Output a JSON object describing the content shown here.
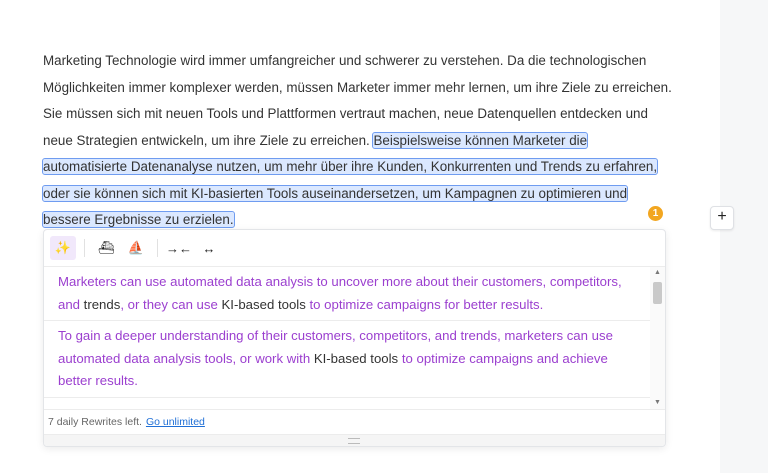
{
  "editor": {
    "lead_text": "Marketing Technologie wird immer umfangreicher und schwerer zu verstehen. Da die technologischen Möglichkeiten immer komplexer werden, müssen Marketer immer mehr lernen, um ihre Ziele zu erreichen. Sie müssen sich mit neuen Tools und Plattformen vertraut machen, neue Datenquellen entdecken und neue Strategien entwickeln, um ihre Ziele zu erreichen. ",
    "selected_text": "Beispielsweise können Marketer die automatisierte Datenanalyse nutzen, um mehr über ihre Kunden, Konkurrenten und Trends zu erfahren, oder sie können sich mit KI-basierten Tools auseinandersetzen, um Kampagnen zu optimieren und bessere Ergebnisse zu erzielen."
  },
  "issue_count": "1",
  "add_block_label": "+",
  "toolbar": {
    "rewrite_icon": "sparkle-icon",
    "formal_icon": "boat-icon",
    "casual_icon": "ship-icon",
    "shorten_icon": "arrows-in-icon",
    "expand_icon": "arrows-out-icon",
    "rewrite_glyph": "✨",
    "formal_glyph": "⛴",
    "casual_glyph": "⛵",
    "shorten_glyph": "→←",
    "expand_glyph": "↔"
  },
  "suggestions": [
    {
      "parts": [
        {
          "text": "Marketers can use automated data analysis to uncover more about their customers, competitors, and ",
          "kept": false
        },
        {
          "text": "trends",
          "kept": true
        },
        {
          "text": ", or they can use ",
          "kept": false
        },
        {
          "text": "KI-based",
          "kept": true
        },
        {
          "text": " ",
          "kept": false
        },
        {
          "text": "tools",
          "kept": true
        },
        {
          "text": " to optimize campaigns for better results.",
          "kept": false
        }
      ]
    },
    {
      "parts": [
        {
          "text": "To gain a deeper understanding of their customers, competitors, and trends, marketers can use automated data analysis tools, or work with ",
          "kept": false
        },
        {
          "text": "KI-based",
          "kept": true
        },
        {
          "text": " ",
          "kept": false
        },
        {
          "text": "tools",
          "kept": true
        },
        {
          "text": " to optimize campaigns and achieve better results.",
          "kept": false
        }
      ]
    }
  ],
  "footer": {
    "rewrites_left": "7 daily Rewrites left.",
    "upgrade_link": "Go unlimited"
  },
  "colors": {
    "rewrite_accent": "#9b3fcf",
    "highlight": "#dbe8ff",
    "badge": "#f2a620",
    "link": "#1f6fd6"
  }
}
